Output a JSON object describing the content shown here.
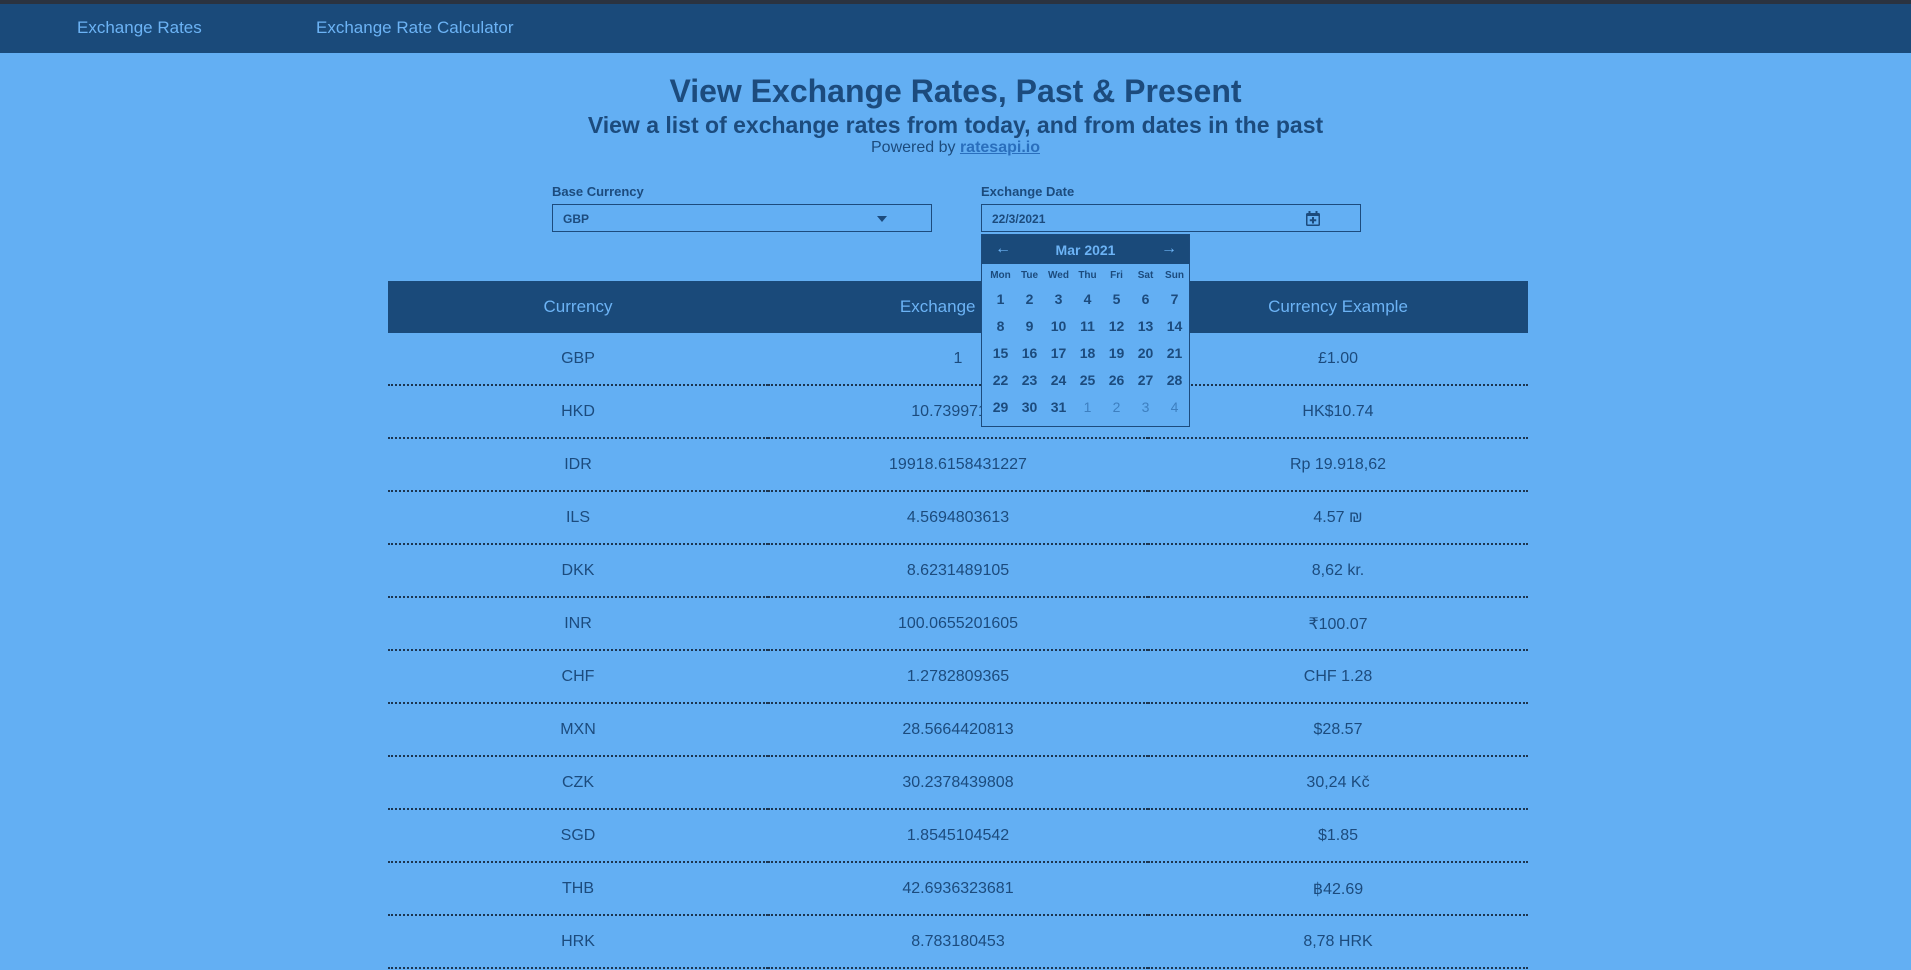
{
  "nav": {
    "links": [
      "Exchange Rates",
      "Exchange Rate Calculator"
    ]
  },
  "header": {
    "title": "View Exchange Rates, Past & Present",
    "subtitle": "View a list of exchange rates from today, and from dates in the past",
    "powered_prefix": "Powered by",
    "powered_link": "ratesapi.io"
  },
  "form": {
    "base_currency_label": "Base Currency",
    "base_currency_value": "GBP",
    "exchange_date_label": "Exchange Date",
    "exchange_date_value": "22/3/2021"
  },
  "calendar": {
    "month_label": "Mar 2021",
    "weekdays": [
      "Mon",
      "Tue",
      "Wed",
      "Thu",
      "Fri",
      "Sat",
      "Sun"
    ],
    "weeks": [
      [
        "1",
        "2",
        "3",
        "4",
        "5",
        "6",
        "7"
      ],
      [
        "8",
        "9",
        "10",
        "11",
        "12",
        "13",
        "14"
      ],
      [
        "15",
        "16",
        "17",
        "18",
        "19",
        "20",
        "21"
      ],
      [
        "22",
        "23",
        "24",
        "25",
        "26",
        "27",
        "28"
      ],
      [
        "29",
        "30",
        "31",
        "1",
        "2",
        "3",
        "4"
      ]
    ],
    "next_month_days_in_last_week": 4
  },
  "table": {
    "headers": [
      "Currency",
      "Exchange Rate",
      "Currency Example"
    ],
    "rows": [
      [
        "GBP",
        "1",
        "£1.00"
      ],
      [
        "HKD",
        "10.73997191",
        "HK$10.74"
      ],
      [
        "IDR",
        "19918.6158431227",
        "Rp 19.918,62"
      ],
      [
        "ILS",
        "4.5694803613",
        "4.57 ₪"
      ],
      [
        "DKK",
        "8.6231489105",
        "8,62 kr."
      ],
      [
        "INR",
        "100.0655201605",
        "₹100.07"
      ],
      [
        "CHF",
        "1.2782809365",
        "CHF 1.28"
      ],
      [
        "MXN",
        "28.5664420813",
        "$28.57"
      ],
      [
        "CZK",
        "30.2378439808",
        "30,24 Kč"
      ],
      [
        "SGD",
        "1.8545104542",
        "$1.85"
      ],
      [
        "THB",
        "42.6936323681",
        "฿42.69"
      ],
      [
        "HRK",
        "8.783180453",
        "8,78 HRK"
      ]
    ]
  },
  "colors": {
    "background": "#63aff3",
    "navbar": "#1a4a7a",
    "nav_text": "#6cb3f5",
    "text": "#1c4b7d",
    "link": "#2a6fbd"
  },
  "icons": {
    "select_caret": "chevron-down-icon",
    "date_picker": "calendar-icon",
    "prev": "arrow-left-icon",
    "next": "arrow-right-icon"
  }
}
